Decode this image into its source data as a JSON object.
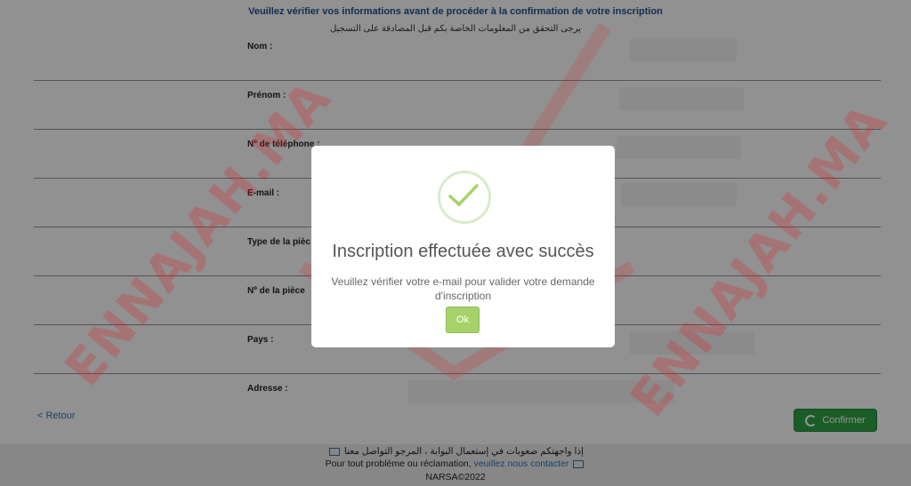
{
  "header": {
    "title_fr": "Veuillez vérifier vos informations avant de procéder à la confirmation de votre inscription",
    "title_ar": "يرجى التحقق من المعلومات الخاصة بكم قبل المصادقة على التسجيل"
  },
  "form": {
    "fields": [
      {
        "label": "Nom :"
      },
      {
        "label": "Prénom :"
      },
      {
        "label": "Nº de téléphone :"
      },
      {
        "label": "E-mail :"
      },
      {
        "label": "Type de la pièc"
      },
      {
        "label": "Nº de la pièce"
      },
      {
        "label": "Pays :"
      },
      {
        "label": "Adresse :"
      }
    ],
    "back_label": "< Retour",
    "confirm_label": "Confirmer"
  },
  "footer": {
    "line_ar": "إذا واجهتكم صعوبات في إستعمال البوابة ، المرجو التواصل معنا",
    "line_fr_prefix": "Pour tout problème ou réclamation,",
    "line_fr_link": "veuillez nous contacter",
    "copyright": "NARSA©2022"
  },
  "watermark": {
    "text": "ENNAJAH.MA"
  },
  "modal": {
    "title": "Inscription effectuée avec succès",
    "message": "Veuillez vérifier votre e-mail pour valider votre demande d'inscription",
    "ok_label": "Ok"
  },
  "colors": {
    "header_blue": "#1f4e8c",
    "confirm_green": "#2ea043",
    "ok_green": "#a5d36a",
    "link_blue": "#2f6fb3"
  }
}
